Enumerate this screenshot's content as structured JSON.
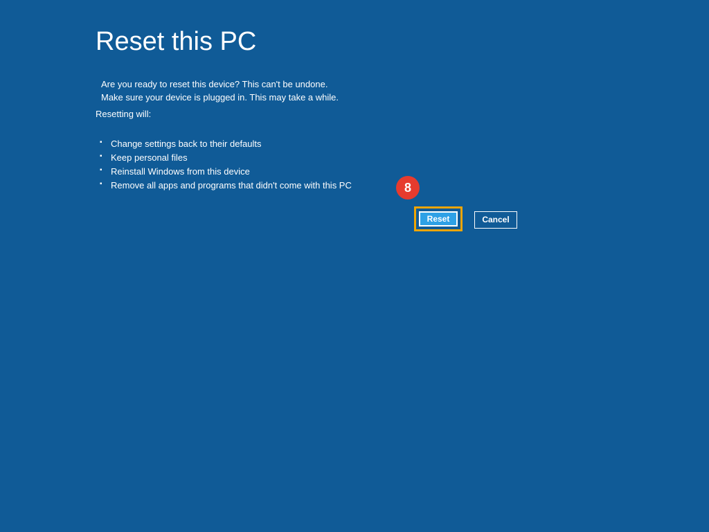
{
  "title": "Reset this PC",
  "intro": {
    "line1": "Are you ready to reset this device? This can't be undone.",
    "line2": "Make sure your device is plugged in. This may take a while."
  },
  "lead": "Resetting will:",
  "bullets": [
    "Change settings back to their defaults",
    "Keep personal files",
    "Reinstall Windows from this device",
    "Remove all apps and programs that didn't come with this PC"
  ],
  "buttons": {
    "reset": "Reset",
    "cancel": "Cancel"
  },
  "annotation": {
    "step_number": "8"
  }
}
